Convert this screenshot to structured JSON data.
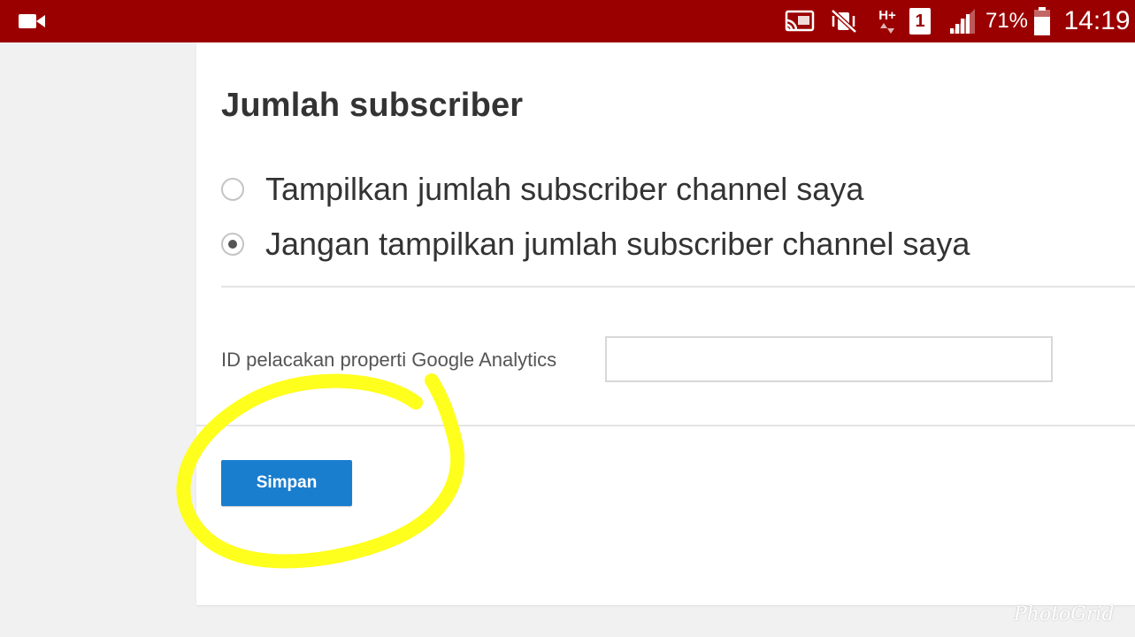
{
  "status_bar": {
    "battery_percent": "71%",
    "time": "14:19",
    "network_type": "H+",
    "sim_slot": "1",
    "icons": [
      "video-camera-icon",
      "cast-icon",
      "vibrate-mute-icon",
      "network-type-icon",
      "sim-icon",
      "signal-icon",
      "battery-icon"
    ],
    "background_color": "#9b0000"
  },
  "settings": {
    "section_title": "Jumlah subscriber",
    "radio_options": [
      {
        "label": "Tampilkan jumlah subscriber channel saya",
        "selected": false
      },
      {
        "label": "Jangan tampilkan jumlah subscriber channel saya",
        "selected": true
      }
    ],
    "analytics": {
      "label": "ID pelacakan properti Google Analytics",
      "value": "",
      "placeholder": ""
    },
    "save_label": "Simpan",
    "accent_color": "#1a7ecf"
  },
  "annotation": {
    "color": "#ffff1e"
  },
  "watermark": "PhotoGrid"
}
